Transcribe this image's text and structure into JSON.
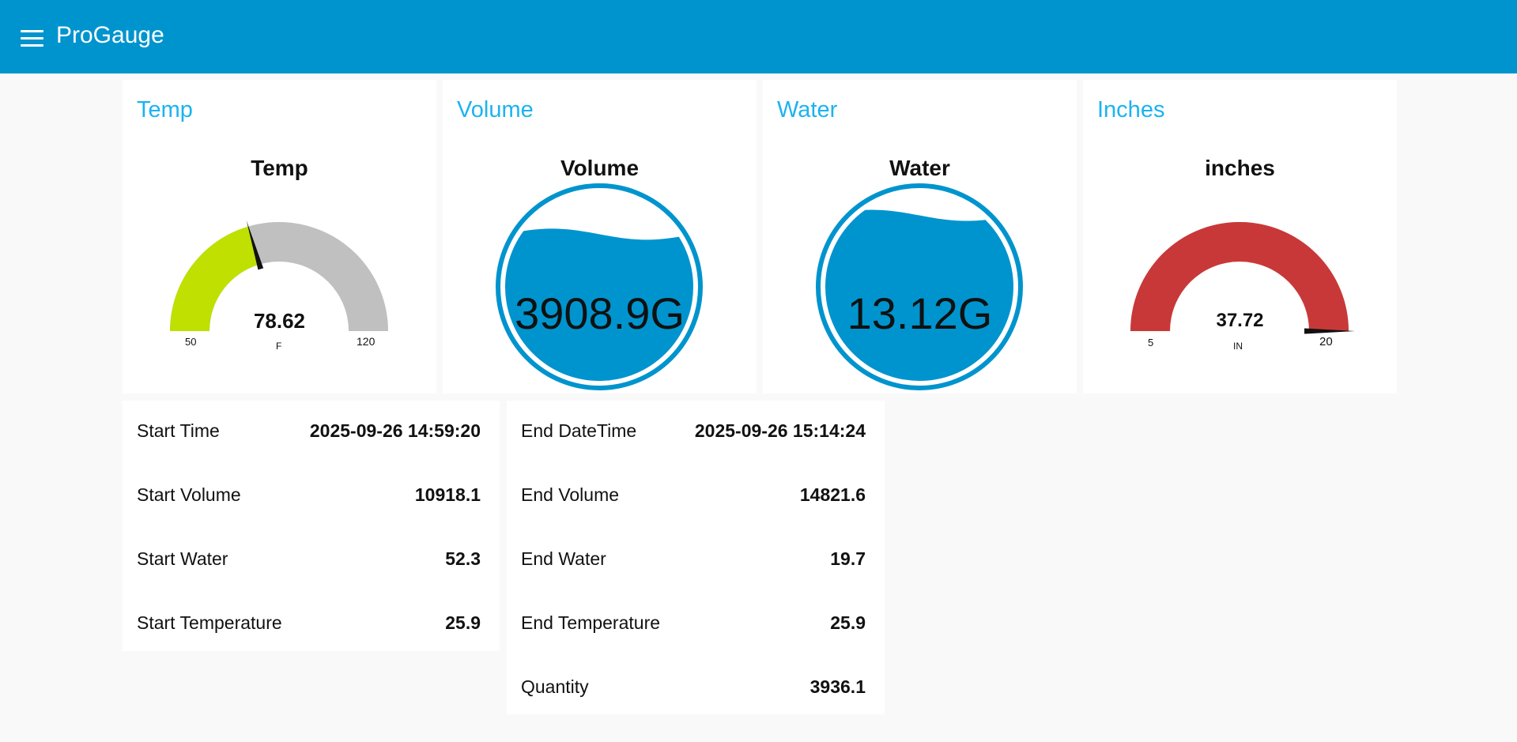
{
  "app": {
    "title": "ProGauge"
  },
  "cards": {
    "temp": {
      "header": "Temp",
      "label": "Temp",
      "value": "78.62",
      "unit": "F",
      "min": "50",
      "max": "120",
      "numeric": 78.62,
      "min_n": 50,
      "max_n": 120,
      "color": "#bfe000"
    },
    "volume": {
      "header": "Volume",
      "label": "Volume",
      "value": "3908.9G",
      "level": 0.78
    },
    "water": {
      "header": "Water",
      "label": "Water",
      "value": "13.12G",
      "level": 0.88
    },
    "inches": {
      "header": "Inches",
      "label": "inches",
      "value": "37.72",
      "unit": "IN",
      "min": "5",
      "max": "20",
      "numeric": 37.72,
      "min_n": 5,
      "max_n": 20,
      "color": "#c93838"
    }
  },
  "colors": {
    "accent": "#0094ce",
    "title_blue": "#1bb3f0",
    "gauge_bg": "#c0c0c0"
  },
  "start": {
    "rows": [
      {
        "label": "Start Time",
        "value": "2025-09-26 14:59:20"
      },
      {
        "label": "Start Volume",
        "value": "10918.1"
      },
      {
        "label": "Start Water",
        "value": "52.3"
      },
      {
        "label": "Start Temperature",
        "value": "25.9"
      }
    ]
  },
  "end": {
    "rows": [
      {
        "label": "End DateTime",
        "value": "2025-09-26 15:14:24"
      },
      {
        "label": "End Volume",
        "value": "14821.6"
      },
      {
        "label": "End Water",
        "value": "19.7"
      },
      {
        "label": "End Temperature",
        "value": "25.9"
      },
      {
        "label": "Quantity",
        "value": "3936.1"
      }
    ]
  }
}
